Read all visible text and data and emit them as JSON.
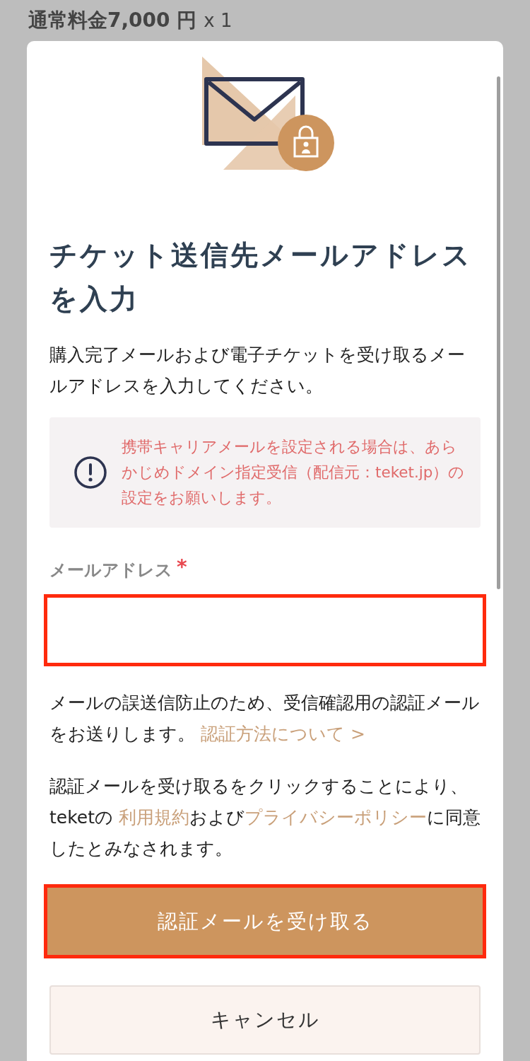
{
  "background": {
    "price": "通常料金7,000 円",
    "quantity": "x 1"
  },
  "dialog": {
    "title": "チケット送信先メールアドレスを入力",
    "intro": "購入完了メールおよび電子チケットを受け取るメールアドレスを入力してください。",
    "notice": "携帯キャリアメールを設定される場合は、あらかじめドメイン指定受信（配信元：teket.jp）の設定をお願いします。",
    "email_field": {
      "label": "メールアドレス",
      "required_mark": "*"
    },
    "verify_note": [
      {
        "kind": "text",
        "text": "メールの誤送信防止のため、受信確認用の認証メールをお送りします。 "
      },
      {
        "kind": "link",
        "text": "認証方法について >"
      }
    ],
    "terms": [
      {
        "kind": "text",
        "text": "認証メールを受け取るをクリックすることにより、teketの "
      },
      {
        "kind": "link",
        "text": "利用規約"
      },
      {
        "kind": "text",
        "text": "および"
      },
      {
        "kind": "link",
        "text": "プライバシーポリシー"
      },
      {
        "kind": "text",
        "text": "に同意したとみなされます。"
      }
    ],
    "submit": "認証メールを受け取る",
    "cancel": "キャンセル"
  }
}
